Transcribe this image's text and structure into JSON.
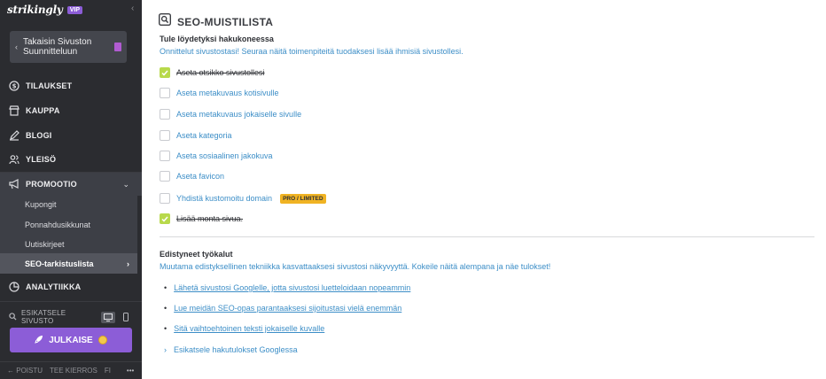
{
  "sidebar": {
    "logo": "strikingly",
    "vip_badge": "VIP",
    "back_label": "Takaisin Sivuston Suunnitteluun",
    "nav": [
      {
        "label": "TILAUKSET",
        "icon": "dollar-icon"
      },
      {
        "label": "KAUPPA",
        "icon": "store-icon"
      },
      {
        "label": "BLOGI",
        "icon": "pen-icon"
      },
      {
        "label": "YLEISÖ",
        "icon": "audience-icon"
      },
      {
        "label": "PROMOOTIO",
        "icon": "megaphone-icon",
        "expanded": true
      },
      {
        "label": "ANALYTIIKKA",
        "icon": "pie-chart-icon"
      }
    ],
    "promo_sub": [
      "Kupongit",
      "Ponnahdusikkunat",
      "Uutiskirjeet",
      "SEO-tarkistuslista"
    ],
    "selected_sub": "SEO-tarkistuslista",
    "preview_label": "ESIKATSELE SIVUSTO",
    "publish_label": "JULKAISE",
    "footer": {
      "logout": "POISTU",
      "tour": "TEE KIERROS",
      "lang": "FI",
      "more": "•••"
    }
  },
  "main": {
    "title": "SEO-MUISTILISTA",
    "search_section": {
      "heading": "Tule löydetyksi hakukoneessa",
      "description": "Onnittelut sivustostasi! Seuraa näitä toimenpiteitä tuodaksesi lisää ihmisiä sivustollesi.",
      "items": [
        {
          "label": "Aseta otsikko sivustollesi",
          "done": true
        },
        {
          "label": "Aseta metakuvaus kotisivulle",
          "done": false
        },
        {
          "label": "Aseta metakuvaus jokaiselle sivulle",
          "done": false
        },
        {
          "label": "Aseta kategoria",
          "done": false
        },
        {
          "label": "Aseta sosiaalinen jakokuva",
          "done": false
        },
        {
          "label": "Aseta favicon",
          "done": false
        },
        {
          "label": "Yhdistä kustomoitu domain",
          "done": false,
          "badge": "PRO / LIMITED"
        },
        {
          "label": "Lisää monta sivua.",
          "done": true
        }
      ]
    },
    "advanced_section": {
      "heading": "Edistyneet työkalut",
      "description": "Muutama edistyksellinen tekniikka kasvattaaksesi sivustosi näkyvyyttä. Kokeile näitä alempana ja näe tulokset!",
      "links": [
        "Lähetä sivustosi Googlelle, jotta sivustosi luetteloidaan nopeammin",
        "Lue meidän SEO-opas parantaaksesi sijoitustasi vielä enemmän",
        "Sitä vaihtoehtoinen teksti jokaiselle kuvalle"
      ],
      "expand_label": "Esikatsele hakutulokset Googlessa"
    }
  },
  "colors": {
    "sidebar_bg": "#2b2c30",
    "accent_purple": "#8c5dd7",
    "link_blue": "#3c8ec7",
    "check_green": "#b8d94b",
    "badge_yellow": "#f0b323"
  }
}
